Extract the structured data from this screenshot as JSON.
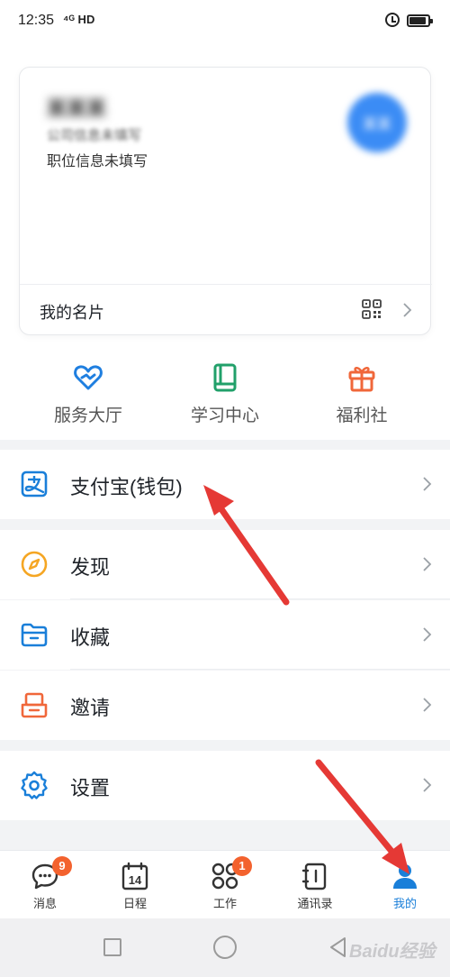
{
  "status": {
    "time": "12:35",
    "network": "⁴ᴳ HD"
  },
  "profile": {
    "name": "某某某",
    "company": "公司信息未填写",
    "position": "职位信息未填写",
    "avatar_text": "某某",
    "card_label": "我的名片"
  },
  "shortcuts": [
    {
      "label": "服务大厅",
      "icon": "heart-service-icon",
      "color": "#1f7fe0"
    },
    {
      "label": "学习中心",
      "icon": "book-icon",
      "color": "#21a06a"
    },
    {
      "label": "福利社",
      "icon": "gift-icon",
      "color": "#f0673a"
    }
  ],
  "menu": {
    "alipay": {
      "label": "支付宝(钱包)",
      "icon": "alipay-icon",
      "color": "#1a7fd9"
    },
    "discover": {
      "label": "发现",
      "icon": "compass-icon",
      "color": "#f5a623"
    },
    "favorites": {
      "label": "收藏",
      "icon": "folder-icon",
      "color": "#1a7fd9"
    },
    "invite": {
      "label": "邀请",
      "icon": "invite-box-icon",
      "color": "#f0673a"
    },
    "settings": {
      "label": "设置",
      "icon": "gear-icon",
      "color": "#1a7fd9"
    }
  },
  "tabs": [
    {
      "label": "消息",
      "icon": "message-icon",
      "badge": "9"
    },
    {
      "label": "日程",
      "icon": "calendar-icon",
      "day": "14"
    },
    {
      "label": "工作",
      "icon": "apps-icon",
      "badge": "1"
    },
    {
      "label": "通讯录",
      "icon": "contacts-book-icon"
    },
    {
      "label": "我的",
      "icon": "profile-icon",
      "active": true
    }
  ],
  "colors": {
    "accent": "#1a7fd9",
    "badge": "#f3622e",
    "arrow": "#e53935"
  },
  "watermark": "Baidu经验"
}
